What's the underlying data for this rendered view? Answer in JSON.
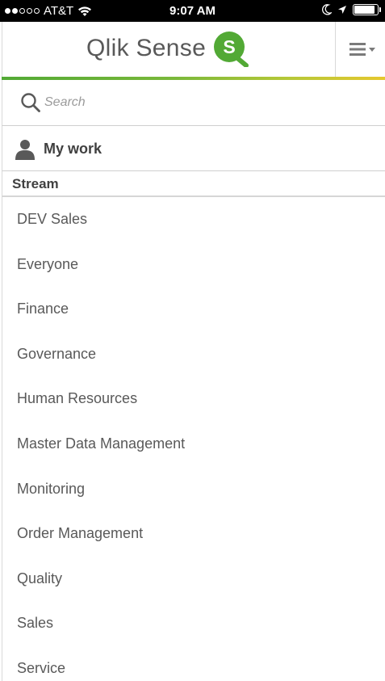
{
  "status_bar": {
    "carrier": "AT&T",
    "time": "9:07 AM",
    "signal_bars_filled": 2,
    "signal_bars_total": 5,
    "battery_level": 0.9,
    "icons": [
      "wifi-icon",
      "moon-icon",
      "location-arrow-icon",
      "battery-icon"
    ]
  },
  "header": {
    "logo_text": "Qlik Sense",
    "logo_trademark": "®",
    "logo_badge_letter": "S",
    "brand_green": "#52a935",
    "menu_icon": "hamburger-menu-icon"
  },
  "search": {
    "placeholder": "Search",
    "value": "",
    "icon": "search-icon"
  },
  "my_work": {
    "label": "My work",
    "icon": "user-icon"
  },
  "stream_section": {
    "title": "Stream",
    "items": [
      {
        "label": "DEV Sales"
      },
      {
        "label": "Everyone"
      },
      {
        "label": "Finance"
      },
      {
        "label": "Governance"
      },
      {
        "label": "Human Resources"
      },
      {
        "label": "Master Data Management"
      },
      {
        "label": "Monitoring"
      },
      {
        "label": "Order Management"
      },
      {
        "label": "Quality"
      },
      {
        "label": "Sales"
      },
      {
        "label": "Service"
      }
    ]
  }
}
